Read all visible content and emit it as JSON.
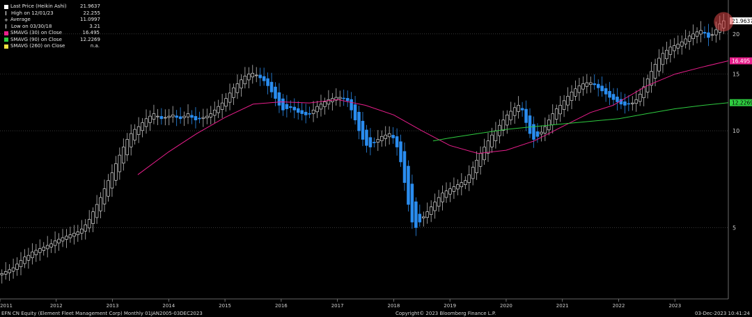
{
  "legend": {
    "items": [
      {
        "label": "Last Price (Heikin Ashi)",
        "value": "21.9637",
        "color": "#ffffff",
        "marker": "square"
      },
      {
        "label": "High on 12/01/23",
        "value": "22.255",
        "color": "#ffffff",
        "marker": "tick"
      },
      {
        "label": "Average",
        "value": "11.0997",
        "color": "#ffffff",
        "marker": "plus"
      },
      {
        "label": "Low on 03/30/18",
        "value": "3.21",
        "color": "#ffffff",
        "marker": "tick"
      },
      {
        "label": "SMAVG (30)  on Close",
        "value": "16.495",
        "color": "#e91e8c",
        "marker": "square"
      },
      {
        "label": "SMAVG (90)  on Close",
        "value": "12.2269",
        "color": "#2ecc40",
        "marker": "square"
      },
      {
        "label": "SMAVG (260)  on Close",
        "value": "n.a.",
        "color": "#f0e040",
        "marker": "square"
      }
    ]
  },
  "footer": {
    "left": "EFN CN Equity (Element Fleet Management Corp)  Monthly 01JAN2005-03DEC2023",
    "center": "Copyright© 2023 Bloomberg Finance L.P.",
    "right": "03-Dec-2023 10:41:24"
  },
  "chart_data": {
    "type": "candlestick",
    "scale": "log",
    "ylim": [
      3.0,
      25.5
    ],
    "xlim": [
      2011.0,
      2023.95
    ],
    "y_ticks": [
      5,
      10,
      15,
      20
    ],
    "x_ticks": [
      "2011",
      "2012",
      "2013",
      "2014",
      "2015",
      "2016",
      "2017",
      "2018",
      "2019",
      "2020",
      "2021",
      "2022",
      "2023"
    ],
    "grid": "horizontal dotted",
    "colors": {
      "up": "#ffffff",
      "down": "#2a8df0",
      "sma30": "#e91e8c",
      "sma90": "#2ecc40",
      "highlight": "#e04848"
    },
    "last_price": {
      "value": 21.9637,
      "label": "21.9637"
    },
    "high": {
      "date": "12/01/23",
      "value": 22.255
    },
    "candles_monthly_close": [
      3.6,
      3.65,
      3.7,
      3.75,
      3.85,
      3.95,
      4.05,
      4.1,
      4.2,
      4.25,
      4.3,
      4.35,
      4.4,
      4.45,
      4.55,
      4.6,
      4.65,
      4.7,
      4.75,
      4.8,
      4.85,
      4.95,
      5.1,
      5.3,
      5.6,
      5.9,
      6.2,
      6.6,
      7.0,
      7.4,
      7.9,
      8.4,
      8.9,
      9.4,
      9.8,
      10.1,
      10.3,
      10.6,
      10.9,
      11.1,
      11.3,
      11.1,
      10.9,
      11.0,
      11.1,
      11.2,
      11.0,
      10.9,
      11.1,
      11.3,
      11.0,
      10.8,
      10.9,
      11.0,
      11.1,
      11.3,
      11.6,
      11.9,
      12.2,
      12.6,
      13.1,
      13.6,
      14.0,
      14.4,
      14.8,
      15.0,
      15.1,
      14.9,
      14.6,
      14.3,
      13.8,
      13.2,
      12.6,
      12.0,
      11.6,
      11.7,
      11.8,
      11.6,
      11.4,
      11.3,
      11.2,
      11.3,
      11.6,
      11.9,
      12.1,
      12.3,
      12.5,
      12.6,
      12.7,
      12.7,
      12.6,
      12.4,
      11.6,
      10.8,
      10.0,
      9.4,
      9.0,
      8.9,
      9.2,
      9.4,
      9.6,
      9.7,
      9.8,
      9.5,
      8.9,
      8.0,
      6.9,
      5.9,
      5.2,
      5.0,
      5.2,
      5.4,
      5.6,
      5.8,
      6.0,
      6.2,
      6.4,
      6.5,
      6.6,
      6.7,
      6.8,
      6.9,
      7.0,
      7.3,
      7.7,
      8.1,
      8.5,
      8.9,
      9.3,
      9.7,
      10.0,
      10.4,
      10.8,
      11.2,
      11.5,
      11.8,
      12.0,
      11.6,
      10.6,
      9.8,
      9.4,
      9.6,
      9.9,
      10.3,
      10.8,
      11.3,
      11.7,
      12.0,
      12.4,
      12.8,
      13.2,
      13.5,
      13.8,
      14.0,
      14.1,
      14.1,
      13.9,
      13.6,
      13.3,
      13.0,
      12.7,
      12.5,
      12.3,
      12.1,
      12.0,
      12.1,
      12.2,
      12.5,
      13.0,
      13.7,
      14.5,
      15.3,
      16.1,
      16.8,
      17.4,
      17.8,
      18.2,
      18.4,
      18.6,
      18.9,
      19.3,
      19.7,
      20.0,
      20.3,
      20.5,
      20.1,
      19.5,
      19.9,
      20.6,
      21.5,
      21.96
    ]
  },
  "sma30": {
    "from": 2013.45,
    "to": 2023.95,
    "points": [
      [
        2013.45,
        7.3
      ],
      [
        2014.0,
        8.6
      ],
      [
        2014.5,
        9.8
      ],
      [
        2015.0,
        11.0
      ],
      [
        2015.5,
        12.1
      ],
      [
        2016.0,
        12.3
      ],
      [
        2016.5,
        12.2
      ],
      [
        2017.0,
        12.5
      ],
      [
        2017.5,
        12.0
      ],
      [
        2018.0,
        11.2
      ],
      [
        2018.5,
        10.0
      ],
      [
        2019.0,
        9.0
      ],
      [
        2019.5,
        8.5
      ],
      [
        2020.0,
        8.7
      ],
      [
        2020.5,
        9.3
      ],
      [
        2021.0,
        10.3
      ],
      [
        2021.5,
        11.4
      ],
      [
        2021.9,
        12.0
      ],
      [
        2022.5,
        13.8
      ],
      [
        2023.0,
        15.0
      ],
      [
        2023.5,
        15.8
      ],
      [
        2023.95,
        16.495
      ]
    ]
  },
  "sma90": {
    "from": 2018.7,
    "to": 2023.95,
    "points": [
      [
        2018.7,
        9.3
      ],
      [
        2019.0,
        9.5
      ],
      [
        2019.5,
        9.8
      ],
      [
        2020.0,
        10.1
      ],
      [
        2020.5,
        10.3
      ],
      [
        2021.0,
        10.5
      ],
      [
        2021.5,
        10.7
      ],
      [
        2022.0,
        10.9
      ],
      [
        2022.5,
        11.3
      ],
      [
        2023.0,
        11.7
      ],
      [
        2023.5,
        12.0
      ],
      [
        2023.95,
        12.2269
      ]
    ]
  }
}
